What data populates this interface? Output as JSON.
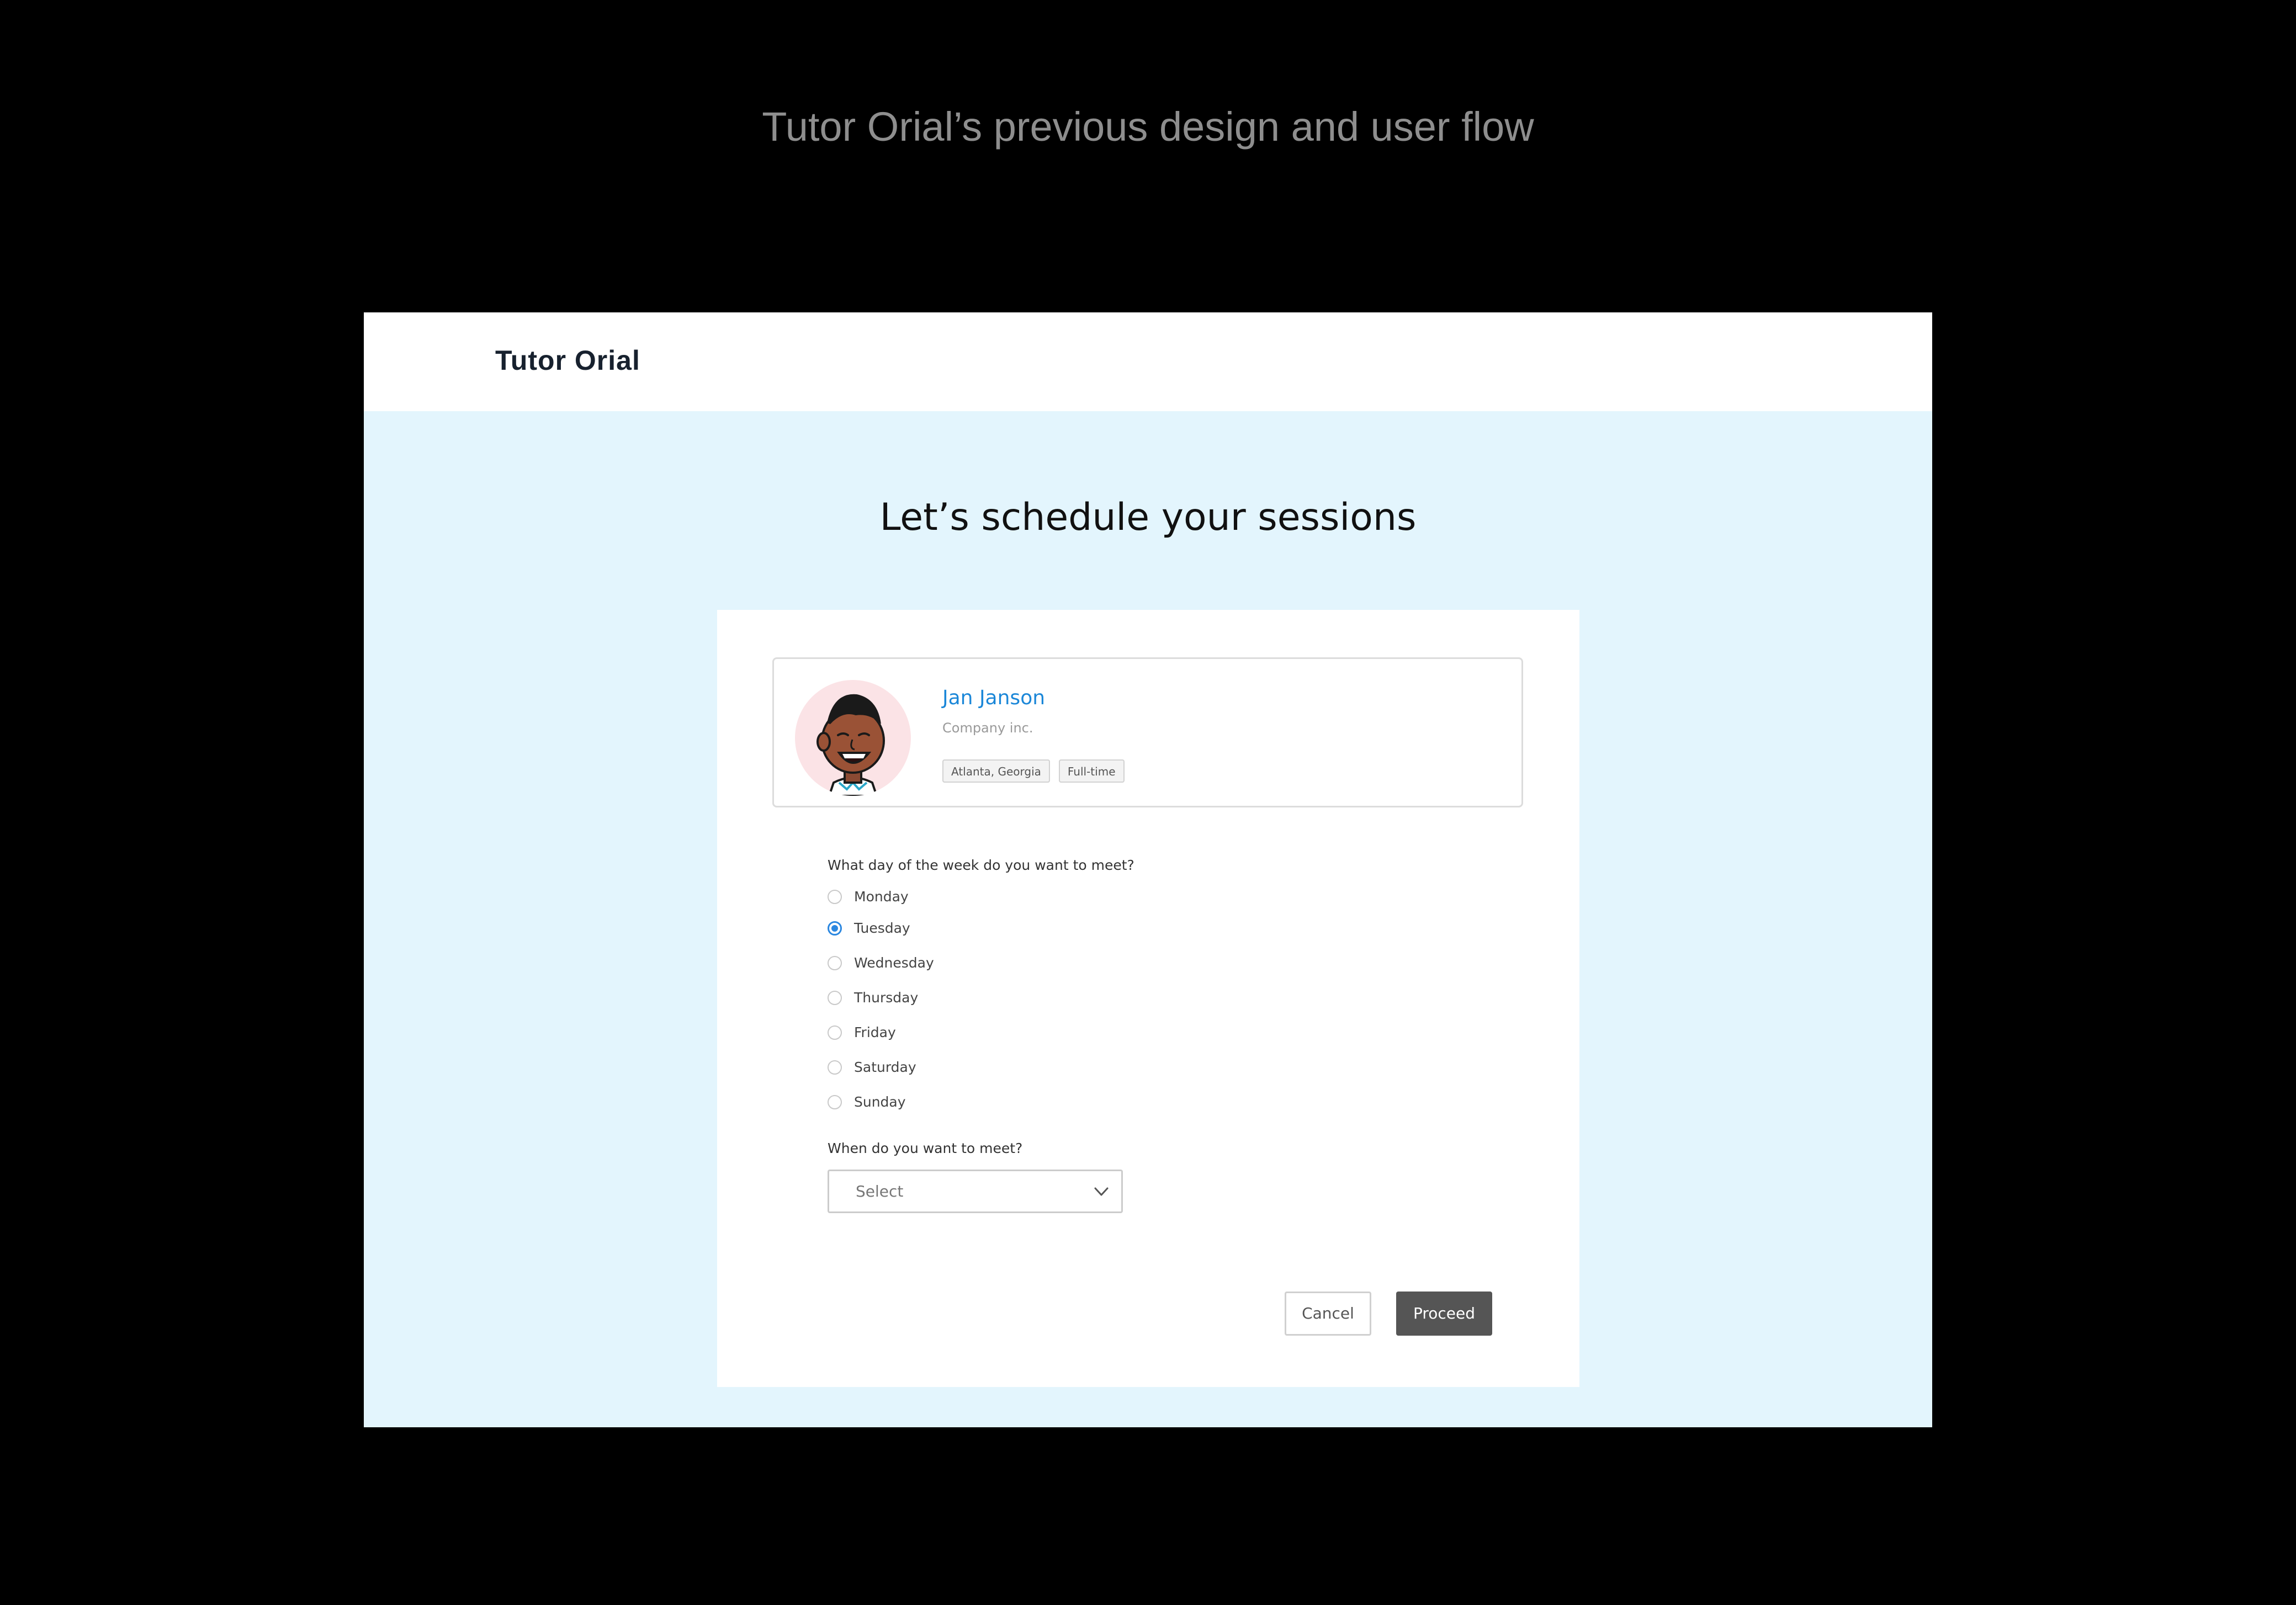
{
  "caption": "Tutor Orial’s previous design and user flow",
  "app": {
    "brand": "Tutor Orial",
    "page_title": "Let’s schedule your sessions"
  },
  "profile": {
    "name": "Jan Janson",
    "company": "Company inc.",
    "tags": [
      "Atlanta, Georgia",
      "Full-time"
    ]
  },
  "day_question": {
    "label": "What day of the week do you want to meet?",
    "options": [
      "Monday",
      "Tuesday",
      "Wednesday",
      "Thursday",
      "Friday",
      "Saturday",
      "Sunday"
    ],
    "selected": "Tuesday"
  },
  "time_question": {
    "label": "When do you want to meet?",
    "select_value": "Select"
  },
  "actions": {
    "cancel_label": "Cancel",
    "proceed_label": "Proceed"
  },
  "colors": {
    "accent": "#2b87e0",
    "background": "#e3f5fd",
    "primary_button": "#555555"
  }
}
